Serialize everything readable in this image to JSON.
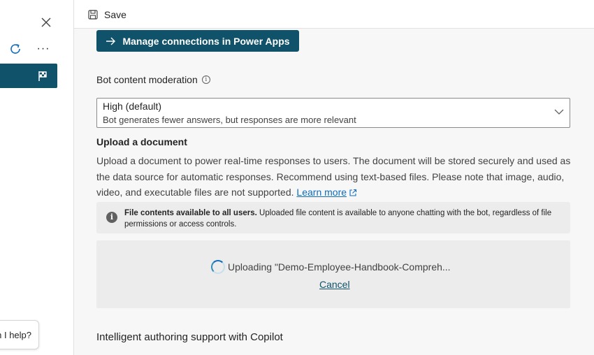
{
  "left_pane": {
    "help_text": "n I help?",
    "icons": {
      "close": "close-icon",
      "refresh": "refresh-icon",
      "more": "more-icon",
      "flag": "flag-icon"
    },
    "more_glyph": "···",
    "accent": "#0f5269"
  },
  "toolbar": {
    "save_label": "Save",
    "save_icon": "save-icon"
  },
  "main": {
    "manage_button_label": "Manage connections in Power Apps",
    "moderation": {
      "label": "Bot content moderation",
      "info_glyph": "i",
      "selected_value": "High (default)",
      "selected_description": "Bot generates fewer answers, but responses are more relevant"
    },
    "upload": {
      "title": "Upload a document",
      "description": "Upload a document to power real-time responses to users. The document will be stored securely and used as the data source for automatic responses. Recommend using text-based files. Please note that image, audio, video, and executable files are not supported.",
      "learn_more": "Learn more",
      "notice_bold": "File contents available to all users.",
      "notice_text": "Uploaded file content is available to anyone chatting with the bot, regardless of file permissions or access controls.",
      "notice_glyph": "i",
      "status_text": "Uploading \"Demo-Employee-Handbook-Compreh...",
      "cancel_label": "Cancel"
    },
    "copilot_title": "Intelligent authoring support with Copilot"
  }
}
